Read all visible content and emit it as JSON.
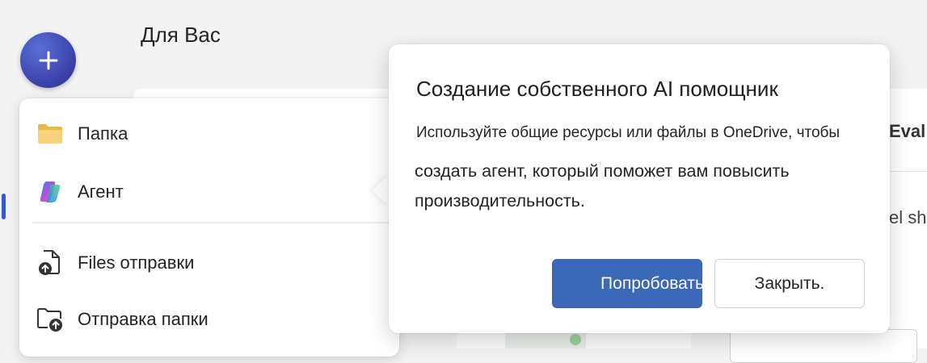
{
  "header": {
    "page_title": "Для Вас"
  },
  "new_menu": {
    "items": [
      {
        "label": "Папка",
        "icon": "folder-icon"
      },
      {
        "label": "Агент",
        "icon": "copilot-agent-icon"
      },
      {
        "label": "Files отправки",
        "icon": "file-upload-icon"
      },
      {
        "label": "Отправка папки",
        "icon": "folder-upload-icon"
      }
    ]
  },
  "callout": {
    "title": "Создание собственного AI помощник",
    "body_line1": "Используйте общие ресурсы или файлы в OneDrive, чтобы",
    "body_line2": "создать агент, который поможет вам повысить производительность.",
    "primary_label": "Попробовать",
    "secondary_label": "Закрыть."
  },
  "background": {
    "right_panel_text_1": "Eval",
    "right_panel_text_2": "el sha"
  },
  "colors": {
    "accent": "#3c68b8",
    "create_button": "#3a3fa8"
  }
}
